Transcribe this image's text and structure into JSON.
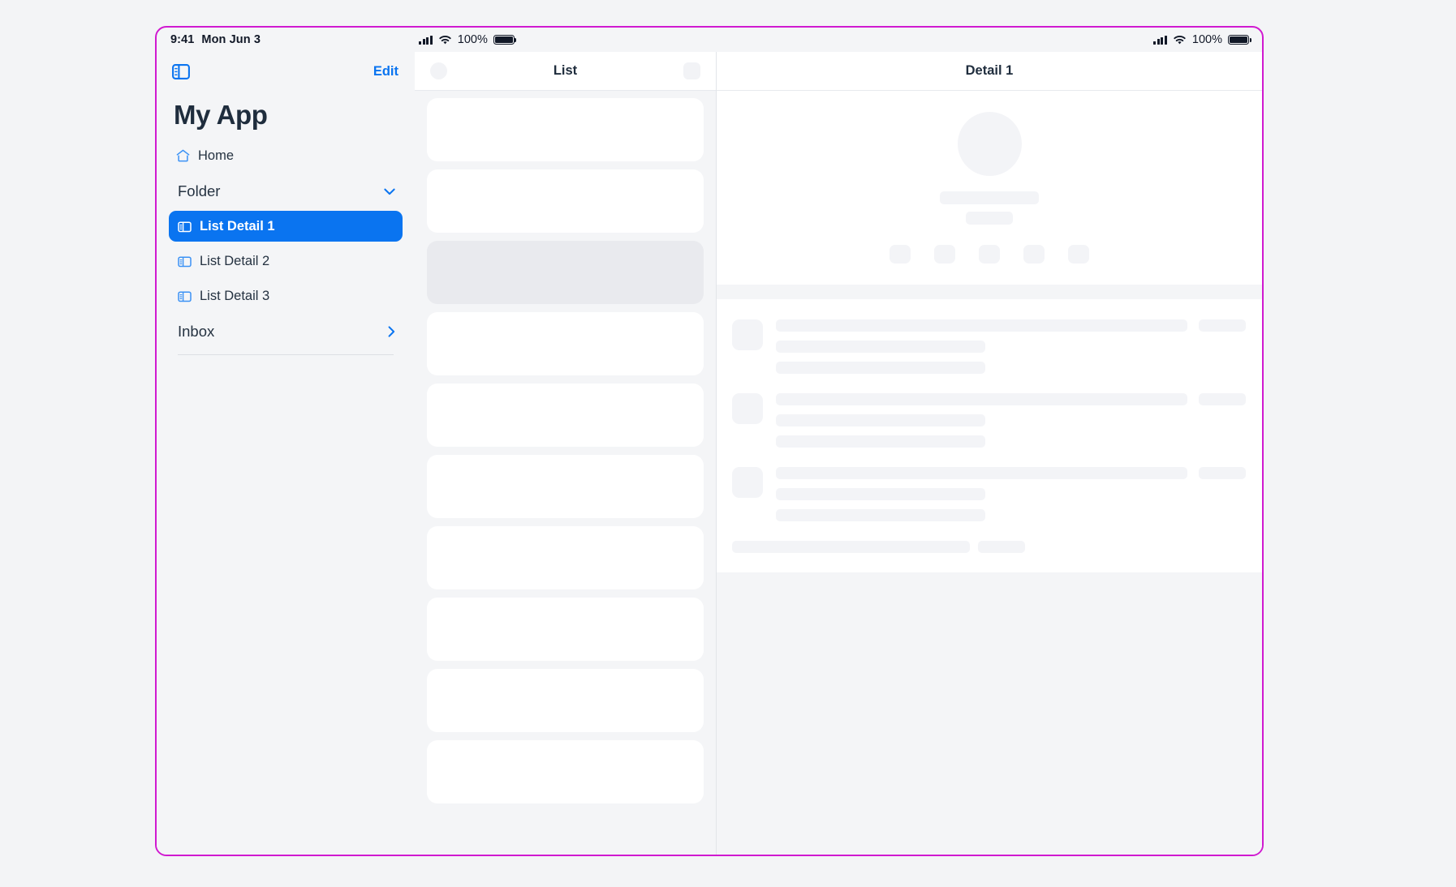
{
  "status_bar": {
    "time": "9:41",
    "date": "Mon Jun 3",
    "battery_percent": "100%",
    "cellular_icon": "signal-bars-icon",
    "wifi_icon": "wifi-icon",
    "battery_icon": "battery-full-icon"
  },
  "sidebar": {
    "toggle_icon": "sidebar-toggle-icon",
    "edit_label": "Edit",
    "app_title": "My App",
    "items": [
      {
        "label": "Home",
        "icon": "home-icon",
        "type": "link",
        "selected": false
      },
      {
        "label": "Folder",
        "icon": "chevron-down-icon",
        "type": "group",
        "selected": false
      },
      {
        "label": "List Detail 1",
        "icon": "list-detail-icon",
        "type": "child",
        "selected": true
      },
      {
        "label": "List Detail 2",
        "icon": "list-detail-icon",
        "type": "child",
        "selected": false
      },
      {
        "label": "List Detail 3",
        "icon": "list-detail-icon",
        "type": "child",
        "selected": false
      },
      {
        "label": "Inbox",
        "icon": "chevron-right-icon",
        "type": "group",
        "selected": false
      }
    ]
  },
  "list_panel": {
    "title": "List",
    "leading_placeholder_icon": "circle-placeholder-icon",
    "trailing_placeholder_icon": "square-placeholder-icon",
    "items": [
      {
        "selected": false
      },
      {
        "selected": false
      },
      {
        "selected": true
      },
      {
        "selected": false
      },
      {
        "selected": false
      },
      {
        "selected": false
      },
      {
        "selected": false
      },
      {
        "selected": false
      },
      {
        "selected": false
      },
      {
        "selected": false
      }
    ]
  },
  "detail_panel": {
    "title": "Detail 1",
    "profile": {
      "avatar_placeholder": "avatar-placeholder",
      "name_placeholder": "name-placeholder",
      "subtitle_placeholder": "subtitle-placeholder",
      "action_count": 5
    },
    "rows": [
      {
        "thumb": "thumbnail-placeholder"
      },
      {
        "thumb": "thumbnail-placeholder"
      },
      {
        "thumb": "thumbnail-placeholder"
      }
    ],
    "footer_placeholder": "footer-placeholder"
  },
  "colors": {
    "accent": "#0a74f0",
    "window_border": "#d019d0",
    "panel_bg": "#f4f5f7",
    "card_bg": "#ffffff",
    "skeleton": "#f3f4f7",
    "selected_list_bg": "#e9eaee",
    "text_primary": "#1f2d3d"
  }
}
